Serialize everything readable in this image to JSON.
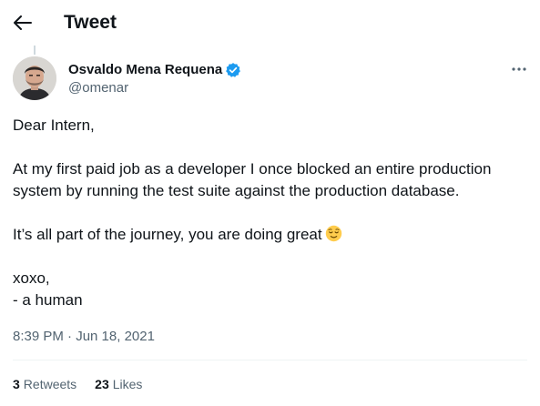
{
  "header": {
    "title": "Tweet",
    "back_icon": "arrow-left-icon"
  },
  "author": {
    "name": "Osvaldo Mena Requena",
    "handle": "@omenar",
    "verified": true,
    "verified_color": "#1d9bf0"
  },
  "tweet": {
    "lines": [
      "Dear Intern,",
      "At my first paid job as a developer I once blocked an entire production system by running the test suite  against the production database.",
      "It’s all part of the journey, you are doing great",
      "xoxo,",
      "- a human"
    ],
    "emoji": "relieved-face-emoji",
    "timestamp": "8:39 PM · Jun 18, 2021"
  },
  "stats": {
    "retweets_count": "3",
    "retweets_label": "Retweets",
    "likes_count": "23",
    "likes_label": "Likes"
  },
  "more_icon": "more-horizontal-icon"
}
